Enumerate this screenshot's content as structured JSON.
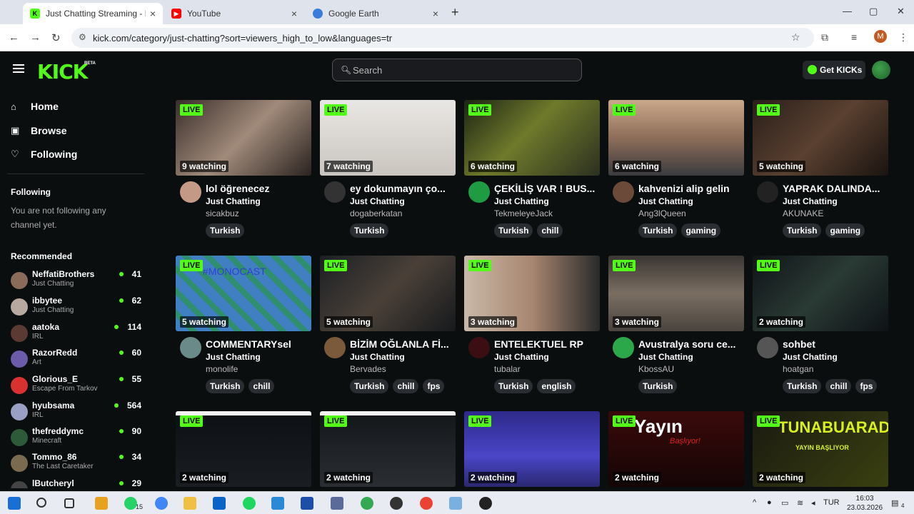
{
  "browser": {
    "tabs": [
      {
        "title": "Just Chatting Streaming - Live S",
        "active": true
      },
      {
        "title": "YouTube",
        "active": false
      },
      {
        "title": "Google Earth",
        "active": false
      }
    ],
    "url": "kick.com/category/just-chatting?sort=viewers_high_to_low&languages=tr",
    "profile_initial": "M"
  },
  "header": {
    "logo": "KICK",
    "beta": "BETA",
    "search_placeholder": "Search",
    "get_kicks": "Get KICKs"
  },
  "sidebar": {
    "nav": [
      {
        "label": "Home",
        "icon": "home-icon"
      },
      {
        "label": "Browse",
        "icon": "browse-icon"
      },
      {
        "label": "Following",
        "icon": "heart-icon"
      }
    ],
    "following_heading": "Following",
    "following_note": "You are not following any channel yet.",
    "recommended_heading": "Recommended",
    "recommended": [
      {
        "name": "NeffatiBrothers",
        "category": "Just Chatting",
        "viewers": "41"
      },
      {
        "name": "ibbytee",
        "category": "Just Chatting",
        "viewers": "62"
      },
      {
        "name": "aatoka",
        "category": "IRL",
        "viewers": "114"
      },
      {
        "name": "RazorRedd",
        "category": "Art",
        "viewers": "60"
      },
      {
        "name": "Glorious_E",
        "category": "Escape From Tarkov",
        "viewers": "55"
      },
      {
        "name": "hyubsama",
        "category": "IRL",
        "viewers": "564"
      },
      {
        "name": "thefreddymc",
        "category": "Minecraft",
        "viewers": "90"
      },
      {
        "name": "Tommo_86",
        "category": "The Last Caretaker",
        "viewers": "34"
      },
      {
        "name": "lButcheryl",
        "category": "",
        "viewers": "29"
      }
    ]
  },
  "live_badge": "LIVE",
  "streams": [
    {
      "watching": "9 watching",
      "title": "lol öğrenecez",
      "category": "Just Chatting",
      "user": "sicakbuz",
      "tags": [
        "Turkish"
      ]
    },
    {
      "watching": "7 watching",
      "title": "ey dokunmayın ço...",
      "category": "Just Chatting",
      "user": "dogaberkatan",
      "tags": [
        "Turkish"
      ]
    },
    {
      "watching": "6 watching",
      "title": "ÇEKİLİŞ VAR ! BUS...",
      "category": "Just Chatting",
      "user": "TekmeleyeJack",
      "tags": [
        "Turkish",
        "chill"
      ]
    },
    {
      "watching": "6 watching",
      "title": "kahvenizi alip gelin",
      "category": "Just Chatting",
      "user": "Ang3lQueen",
      "tags": [
        "Turkish",
        "gaming"
      ]
    },
    {
      "watching": "5 watching",
      "title": "YAPRAK DALINDA...",
      "category": "Just Chatting",
      "user": "AKUNAKE",
      "tags": [
        "Turkish",
        "gaming"
      ]
    },
    {
      "watching": "5 watching",
      "title": "COMMENTARYsel",
      "category": "Just Chatting",
      "user": "monolife",
      "tags": [
        "Turkish",
        "chill"
      ],
      "thumb_text": "#MONOCAST"
    },
    {
      "watching": "5 watching",
      "title": "BİZİM OĞLANLA Fİ...",
      "category": "Just Chatting",
      "user": "Bervades",
      "tags": [
        "Turkish",
        "chill",
        "fps"
      ]
    },
    {
      "watching": "3 watching",
      "title": "ENTELEKTUEL RP",
      "category": "Just Chatting",
      "user": "tubalar",
      "tags": [
        "Turkish",
        "english"
      ]
    },
    {
      "watching": "3 watching",
      "title": "Avustralya soru ce...",
      "category": "Just Chatting",
      "user": "KbossAU",
      "tags": [
        "Turkish"
      ]
    },
    {
      "watching": "2 watching",
      "title": "sohbet",
      "category": "Just Chatting",
      "user": "hoatgan",
      "tags": [
        "Turkish",
        "chill",
        "fps"
      ]
    },
    {
      "watching": "2 watching"
    },
    {
      "watching": "2 watching"
    },
    {
      "watching": "2 watching"
    },
    {
      "watching": "2 watching",
      "thumb_text": "Yayın",
      "thumb_sub": "Başlıyor!"
    },
    {
      "watching": "2 watching",
      "thumb_text": "TUNABUARADA",
      "thumb_sub": "YAYIN BAŞLIYOR"
    }
  ],
  "taskbar": {
    "whatsapp_badge": "15",
    "lang": "TUR",
    "time": "16:03",
    "date": "23.03.2026",
    "notif": "4"
  }
}
